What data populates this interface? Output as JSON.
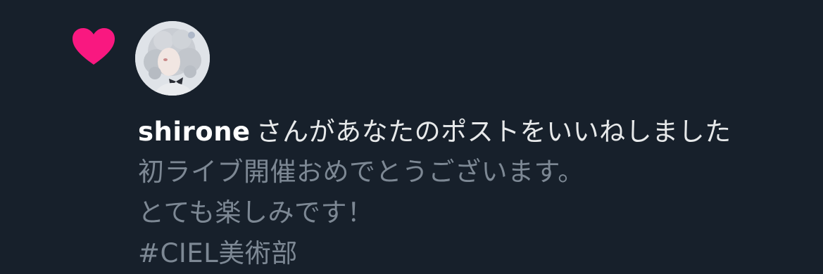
{
  "notification": {
    "icon": "heart-icon",
    "icon_color": "#f91880",
    "avatar": "avatar",
    "username": "shirone",
    "action_text": "さんがあなたのポストをいいねしました",
    "post_lines": [
      "初ライブ開催おめでとうございます。",
      "とても楽しみです！",
      "#CIEL美術部"
    ]
  },
  "colors": {
    "background": "#17202b",
    "primary_text": "#e7e9ea",
    "secondary_text": "#7d8894"
  }
}
